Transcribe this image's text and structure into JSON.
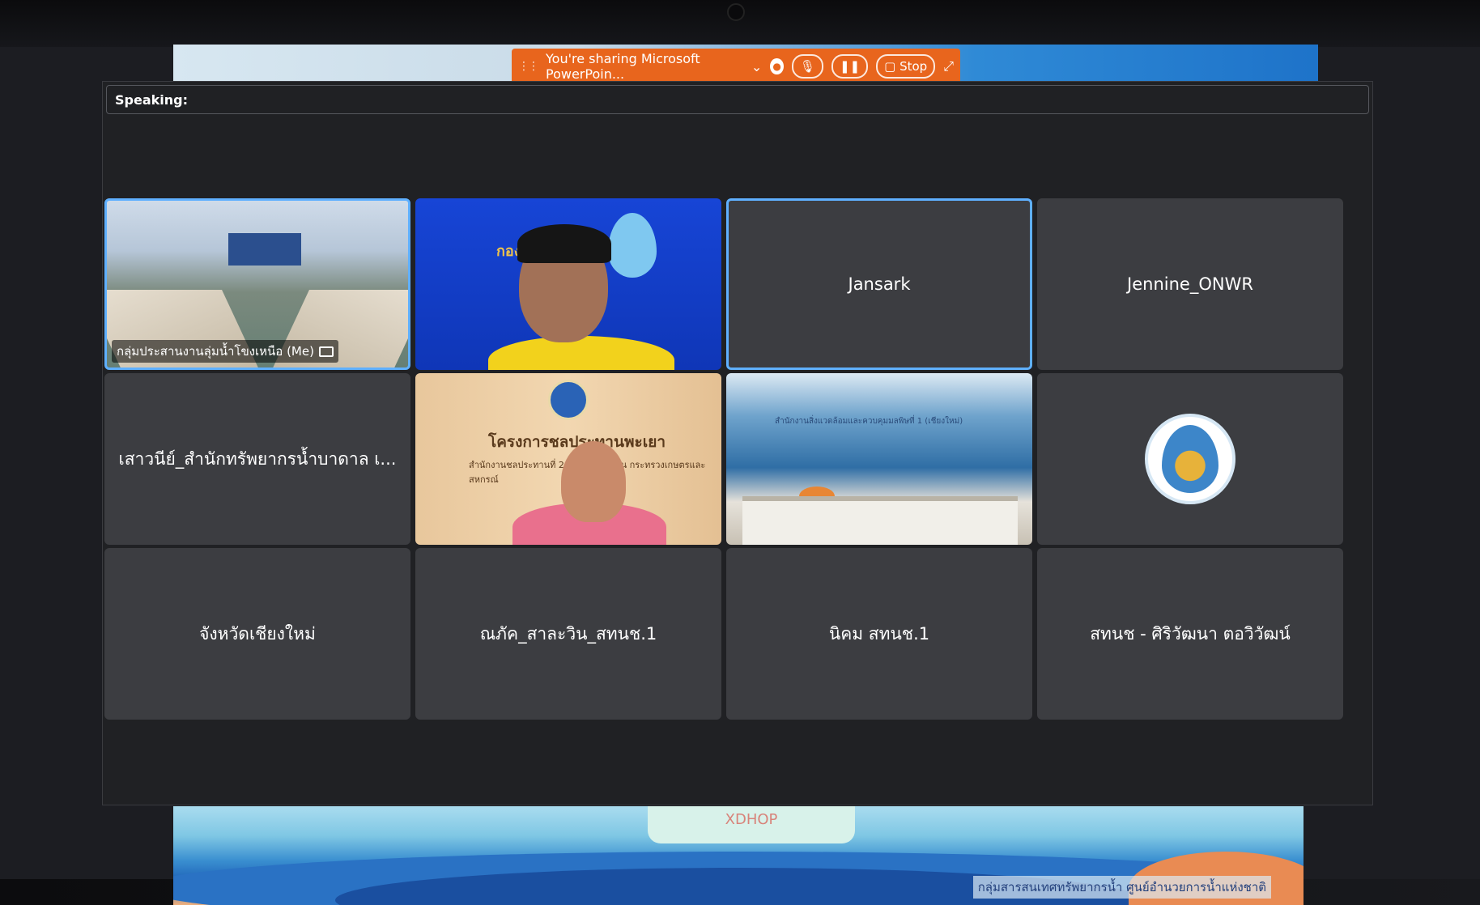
{
  "share_bar": {
    "message": "You're sharing Microsoft PowerPoin...",
    "stop_label": "Stop"
  },
  "meeting": {
    "speaking_label": "Speaking:"
  },
  "participants": [
    {
      "name": "กลุ่มประสานงานลุ่มน้ำโขงเหนือ (Me)",
      "type": "video"
    },
    {
      "name": "",
      "type": "video"
    },
    {
      "name": "Jansark",
      "type": "name"
    },
    {
      "name": "Jennine_ONWR",
      "type": "name"
    },
    {
      "name": "เสาวนีย์_สำนักทรัพยากรน้ำบาดาล เ...",
      "type": "name"
    },
    {
      "name": "",
      "type": "video"
    },
    {
      "name": "",
      "type": "video"
    },
    {
      "name": "",
      "type": "avatar"
    },
    {
      "name": "จังหวัดเชียงใหม่",
      "type": "name"
    },
    {
      "name": "ณภัค_สาละวิน_สทนช.1",
      "type": "name"
    },
    {
      "name": "นิคม สทนช.1",
      "type": "name"
    },
    {
      "name": "สทนช - ศิริวัฒนา ตอวิวัฒน์",
      "type": "name"
    }
  ],
  "slides": {
    "wood_title": "โครงการชลประทานพะเยา",
    "wood_sub": "สำนักงานชลประทานที่ 2 กรมชลประทาน กระทรวงเกษตรและสหกรณ์",
    "blue_logo": "กองอำนวย",
    "mountain_caption": "สำนักงานสิ่งแวดล้อมและควบคุมมลพิษที่ 1 (เชียงใหม่)"
  },
  "banner": {
    "badge_text": "XDHOP",
    "caption": "กลุ่มสารสนเทศทรัพยากรน้ำ ศูนย์อำนวยการน้ำแห่งชาติ"
  }
}
